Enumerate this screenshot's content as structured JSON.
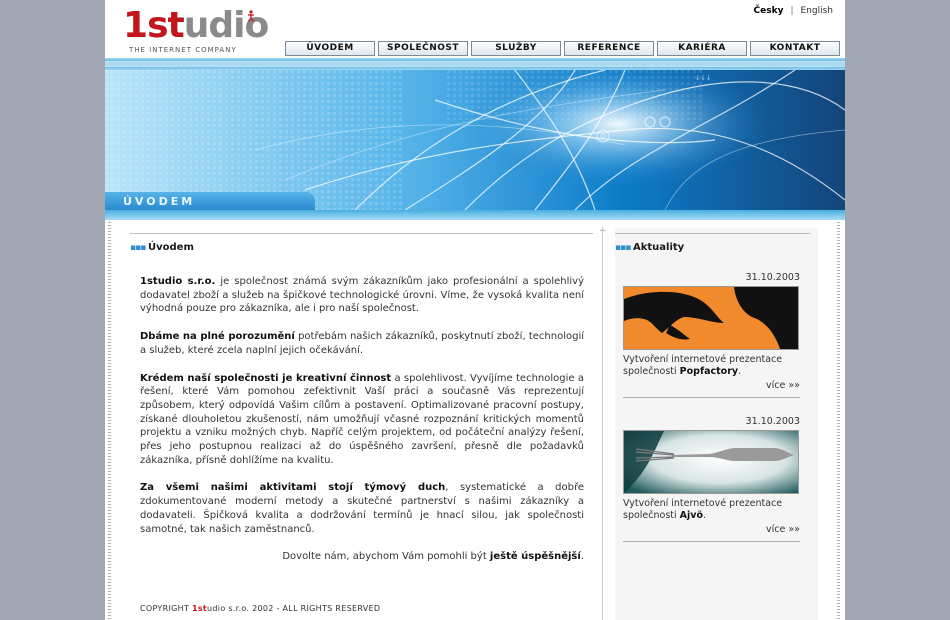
{
  "header": {
    "logo": {
      "one": "1",
      "st": "st",
      "udio": "udio",
      "tagline": "THE INTERNET COMPANY"
    },
    "languages": [
      {
        "label": "Česky",
        "active": true
      },
      {
        "label": "English",
        "active": false
      }
    ],
    "nav": [
      "ÚVODEM",
      "SPOLEČNOST",
      "SLUŽBY",
      "REFERENCE",
      "KARIÉRA",
      "KONTAKT"
    ]
  },
  "banner": {
    "label": "ÚVODEM"
  },
  "main": {
    "title": "Úvodem",
    "paragraphs": [
      {
        "lead": "1studio s.r.o.",
        "text": " je společnost známá svým zákazníkům jako profesionální a spolehlivý dodavatel zboží a služeb na špičkové technologické úrovni. Víme, že vysoká kvalita není výhodná pouze pro zákazníka, ale i pro naší společnost."
      },
      {
        "lead": "Dbáme na plné porozumění",
        "text": " potřebám našich zákazníků, poskytnutí zboží, technologií a služeb, které zcela naplní jejich očekávání."
      },
      {
        "lead": "Krédem naší společnosti je kreativní činnost",
        "text": " a spolehlivost. Vyvíjíme technologie a řešení, které Vám pomohou zefektivnit Vaší práci a současně Vás reprezentují způsobem, který odpovídá Vašim cílům a postavení. Optimalizované pracovní postupy, získané dlouholetou zkušeností, nám umožňují včasné rozpoznání kritických momentů projektu a vzniku možných chyb. Napříč celým projektem, od počáteční analýzy řešení, přes jeho postupnou realizaci až do úspěšného završení, přesně dle požadavků zákazníka, přísně dohlížíme na kvalitu."
      },
      {
        "lead": "Za všemi našimi aktivitami stojí týmový duch",
        "text": ", systematické a dobře zdokumentované moderní metody a skutečné partnerství s našimi zákazníky a dodavateli. Špičková kvalita a dodržování termínů je hnací silou, jak společnosti samotné, tak našich zaměstnanců."
      }
    ],
    "closing": {
      "text": "Dovolte nám, abychom Vám pomohli být ",
      "bold": "ještě úspěšnější",
      "end": "."
    },
    "copyright": {
      "prefix": "COPYRIGHT ",
      "brand1": "1st",
      "brand2": "udio s.r.o. 2002 - ALL RIGHTS RESERVED"
    }
  },
  "news": {
    "title": "Aktuality",
    "items": [
      {
        "date": "31.10.2003",
        "text": "Vytvoření internetové prezentace společnosti ",
        "bold": "Popfactory",
        "end": ".",
        "more": "více »»",
        "image": "popfactory-orange-illustration"
      },
      {
        "date": "31.10.2003",
        "text": "Vytvoření internetové prezentace společnosti ",
        "bold": "Ajvö",
        "end": ".",
        "more": "více »»",
        "image": "fork-photo"
      }
    ]
  },
  "colors": {
    "accent_blue": "#3aa2dc",
    "brand_red": "#c0161c",
    "page_bg": "#a3a7b4"
  }
}
